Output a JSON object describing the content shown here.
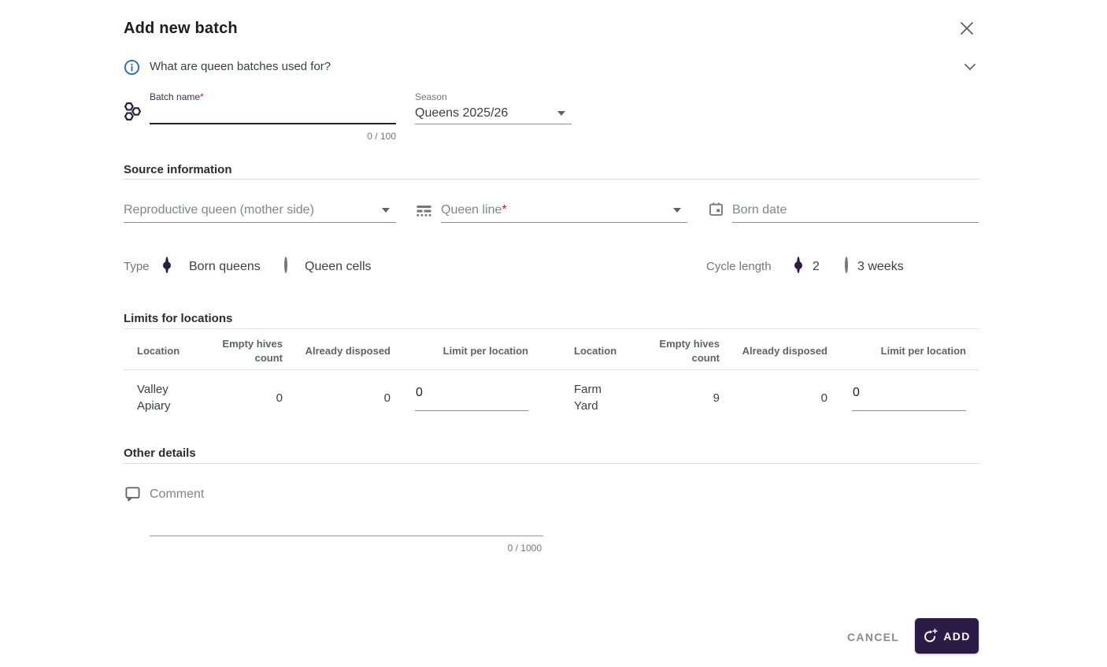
{
  "colors": {
    "primary": "#2a1c47",
    "info_blue": "#1a6fdb",
    "required_red": "#c5221f"
  },
  "dialog": {
    "title": "Add new batch",
    "banner": {
      "text": "What are queen batches used for?"
    },
    "fields": {
      "batch_name": {
        "label": "Batch name",
        "required_mark": "*",
        "value": "",
        "counter": "0 / 100"
      },
      "season": {
        "label": "Season",
        "value": "Queens 2025/26"
      },
      "source_type": {
        "value": "Reproductive queen (mother side)"
      },
      "queen_line": {
        "placeholder": "Queen line",
        "required_mark": "*"
      },
      "born_date": {
        "placeholder": "Born date"
      },
      "comment": {
        "placeholder": "Comment",
        "counter": "0 / 1000"
      }
    },
    "sections": {
      "source": "Source information",
      "limits": "Limits for locations",
      "other": "Other details"
    },
    "type_group": {
      "label": "Type",
      "option1": "Born queens",
      "option2": "Queen cells"
    },
    "cycle_group": {
      "label": "Cycle length",
      "option1": "2",
      "option2": "3 weeks"
    },
    "limits_table": {
      "columns": {
        "location": "Location",
        "empty": "Empty hives count",
        "disposed": "Already disposed",
        "limit": "Limit per location"
      },
      "rows": [
        {
          "location": "Valley Apiary",
          "empty": "0",
          "disposed": "0",
          "limit": "0"
        },
        {
          "location": "Farm Yard",
          "empty": "9",
          "disposed": "0",
          "limit": "0"
        }
      ]
    },
    "footer": {
      "cancel": "CANCEL",
      "add": "ADD"
    }
  }
}
